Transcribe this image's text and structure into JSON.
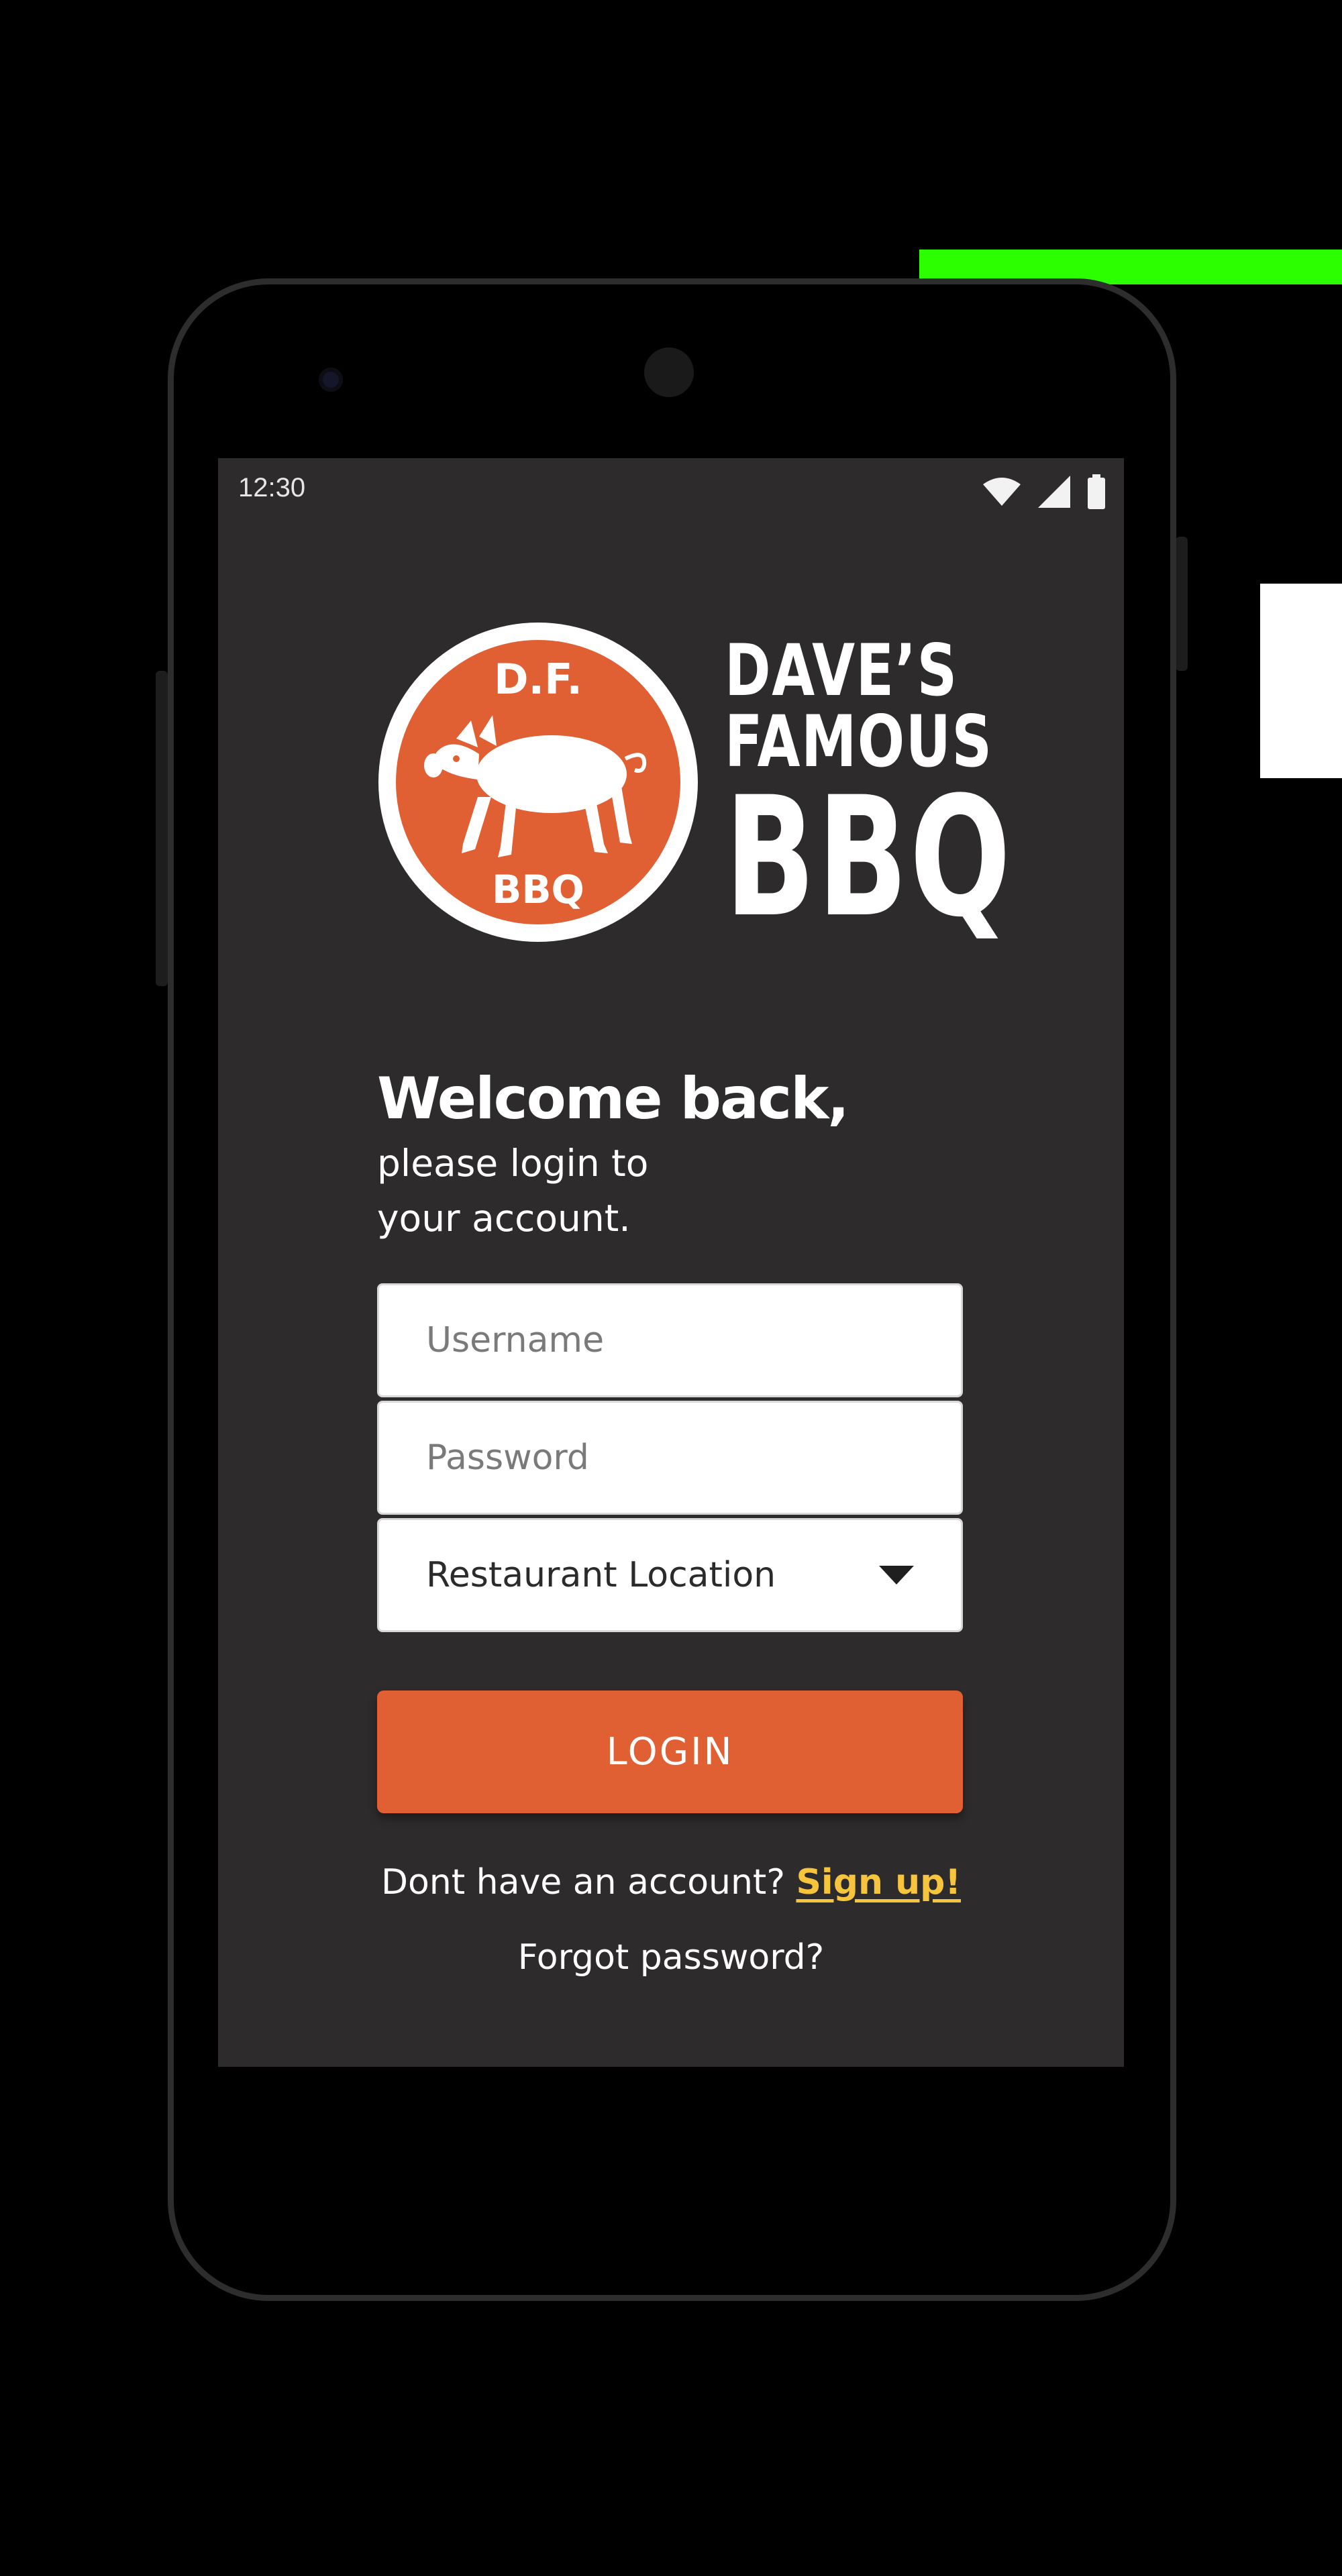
{
  "status_bar": {
    "time": "12:30",
    "icons": [
      "wifi-icon",
      "signal-icon",
      "battery-icon"
    ]
  },
  "brand": {
    "badge_top": "D.F.",
    "badge_bottom": "BBQ",
    "name_line1": "DAVE’S",
    "name_line2": "FAMOUS",
    "name_line3": "BBQ",
    "badge_color": "#e05f33"
  },
  "login": {
    "heading": "Welcome back,",
    "subtitle_line1": "please login to",
    "subtitle_line2": "your account.",
    "username_placeholder": "Username",
    "password_placeholder": "Password",
    "location_label": "Restaurant Location",
    "button_label": "LOGIN",
    "signup_prompt": "Dont have an account?",
    "signup_link": "Sign up!",
    "forgot_password": "Forgot password?"
  },
  "colors": {
    "screen_background": "#2d2b2b",
    "accent": "#e05f33",
    "link": "#f6c53d"
  }
}
